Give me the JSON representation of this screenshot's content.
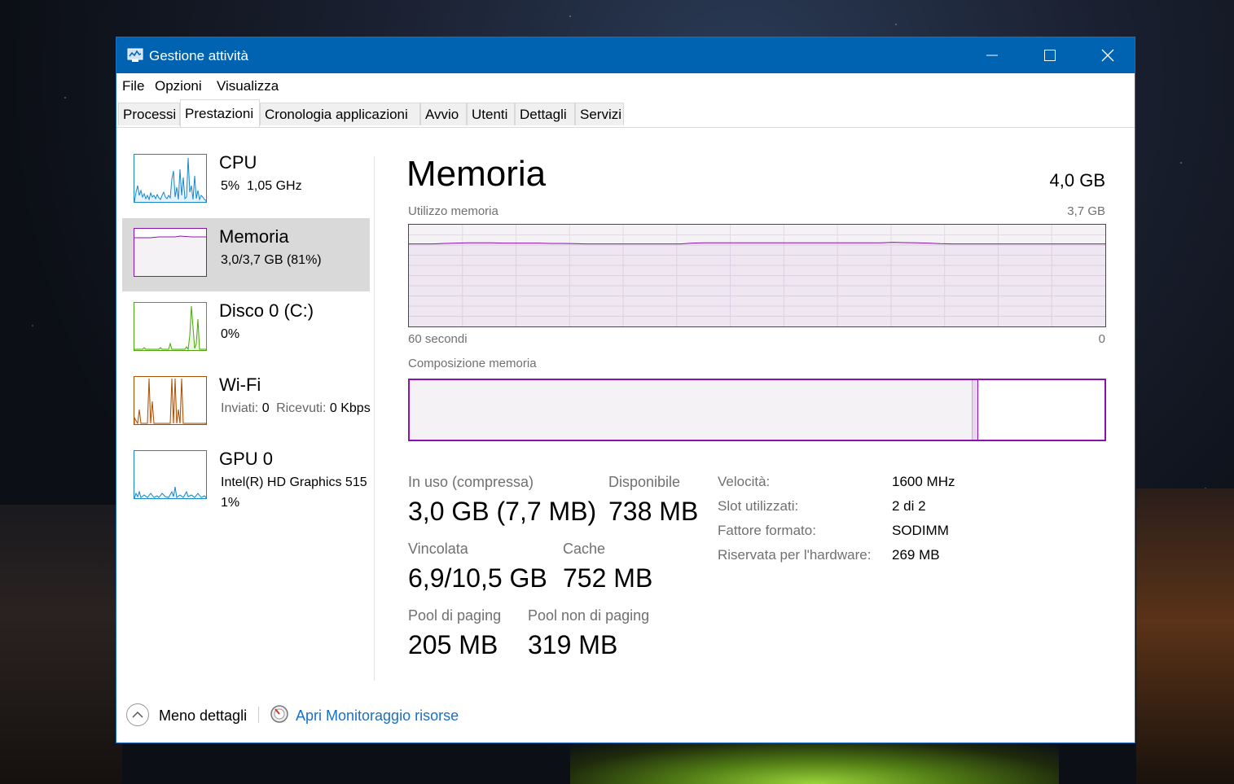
{
  "window": {
    "title": "Gestione attività"
  },
  "menu": [
    "File",
    "Opzioni",
    "Visualizza"
  ],
  "tabs": [
    {
      "label": "Processi",
      "active": false
    },
    {
      "label": "Prestazioni",
      "active": true
    },
    {
      "label": "Cronologia applicazioni",
      "active": false
    },
    {
      "label": "Avvio",
      "active": false
    },
    {
      "label": "Utenti",
      "active": false
    },
    {
      "label": "Dettagli",
      "active": false
    },
    {
      "label": "Servizi",
      "active": false
    }
  ],
  "sidebar": {
    "cpu": {
      "title": "CPU",
      "sub": "5%  1,05 GHz"
    },
    "memory": {
      "title": "Memoria",
      "sub": "3,0/3,7 GB (81%)"
    },
    "disk": {
      "title": "Disco 0 (C:)",
      "sub": "0%"
    },
    "wifi": {
      "title": "Wi-Fi",
      "sent_label": "Inviati:",
      "sent_value": "0",
      "recv_label": "Ricevuti:",
      "recv_value": "0 Kbps"
    },
    "gpu": {
      "title": "GPU 0",
      "sub": "Intel(R) HD Graphics 515",
      "sub2": "1%"
    }
  },
  "main": {
    "title": "Memoria",
    "total": "4,0 GB",
    "usage_label": "Utilizzo memoria",
    "usage_max": "3,7 GB",
    "axis_left": "60 secondi",
    "axis_right": "0",
    "composition_label": "Composizione memoria",
    "composition": {
      "in_use": 0.81,
      "modified": 0.008
    },
    "stats": {
      "in_use_label": "In uso (compressa)",
      "in_use_value": "3,0 GB (7,7 MB)",
      "available_label": "Disponibile",
      "available_value": "738 MB",
      "committed_label": "Vincolata",
      "committed_value": "6,9/10,5 GB",
      "cached_label": "Cache",
      "cached_value": "752 MB",
      "paged_label": "Pool di paging",
      "paged_value": "205 MB",
      "nonpaged_label": "Pool non di paging",
      "nonpaged_value": "319 MB"
    },
    "specs": {
      "speed_label": "Velocità:",
      "speed_value": "1600 MHz",
      "slots_label": "Slot utilizzati:",
      "slots_value": "2 di 2",
      "form_label": "Fattore formato:",
      "form_value": "SODIMM",
      "reserved_label": "Riservata per l'hardware:",
      "reserved_value": "269 MB"
    }
  },
  "footer": {
    "less_details": "Meno dettagli",
    "resource_monitor": "Apri Monitoraggio risorse"
  },
  "colors": {
    "titlebar": "#0063b1",
    "memory": "#8b12ae",
    "cpu": "#1787c8",
    "disk": "#4da60c",
    "wifi": "#a74f01",
    "link": "#1a6fc7"
  },
  "chart_data": {
    "type": "line",
    "ylim": [
      0,
      3.7
    ],
    "series": [
      {
        "values": [
          3.0,
          3.0,
          3.0,
          3.02,
          3.03,
          3.04,
          3.04,
          3.04,
          3.03,
          3.03,
          3.03,
          3.03,
          3.02,
          3.02,
          3.01,
          3.0,
          3.0,
          3.0,
          3.0,
          3.0,
          3.0,
          3.0,
          3.0,
          3.0,
          3.03,
          3.04,
          3.04,
          3.04,
          3.04,
          3.04,
          3.04,
          3.04,
          3.04,
          3.04,
          3.04,
          3.04,
          3.04,
          3.04,
          3.04,
          3.04,
          3.04,
          3.06,
          3.05,
          3.04,
          3.03,
          3.01,
          3.0,
          3.0,
          3.0,
          3.0,
          3.0,
          3.0,
          3.0,
          3.0,
          3.0,
          3.0,
          3.0,
          3.0,
          3.0,
          3.0
        ]
      }
    ]
  }
}
